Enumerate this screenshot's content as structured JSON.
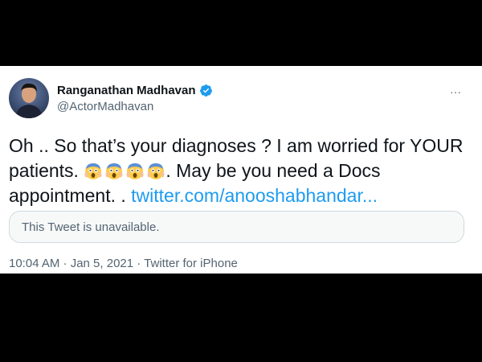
{
  "tweet": {
    "author_name": "Ranganathan Madhavan",
    "handle": "@ActorMadhavan",
    "more_icon": "···",
    "text_part1": "Oh  .. So that’s your diagnoses ? I am worried for YOUR patients. ",
    "text_part2": ". May be you need a Docs appointment. . ",
    "link": "twitter.com/anooshabhandar...",
    "emojis": [
      "scream-emoji",
      "scream-emoji",
      "scream-emoji",
      "scream-emoji"
    ],
    "quote_text": "This Tweet is unavailable.",
    "meta": "10:04 AM · Jan 5, 2021 · Twitter for iPhone"
  },
  "colors": {
    "link": "#1d9bf0",
    "verified": "#1d9bf0",
    "text": "#0f1419",
    "secondary": "#536471"
  }
}
